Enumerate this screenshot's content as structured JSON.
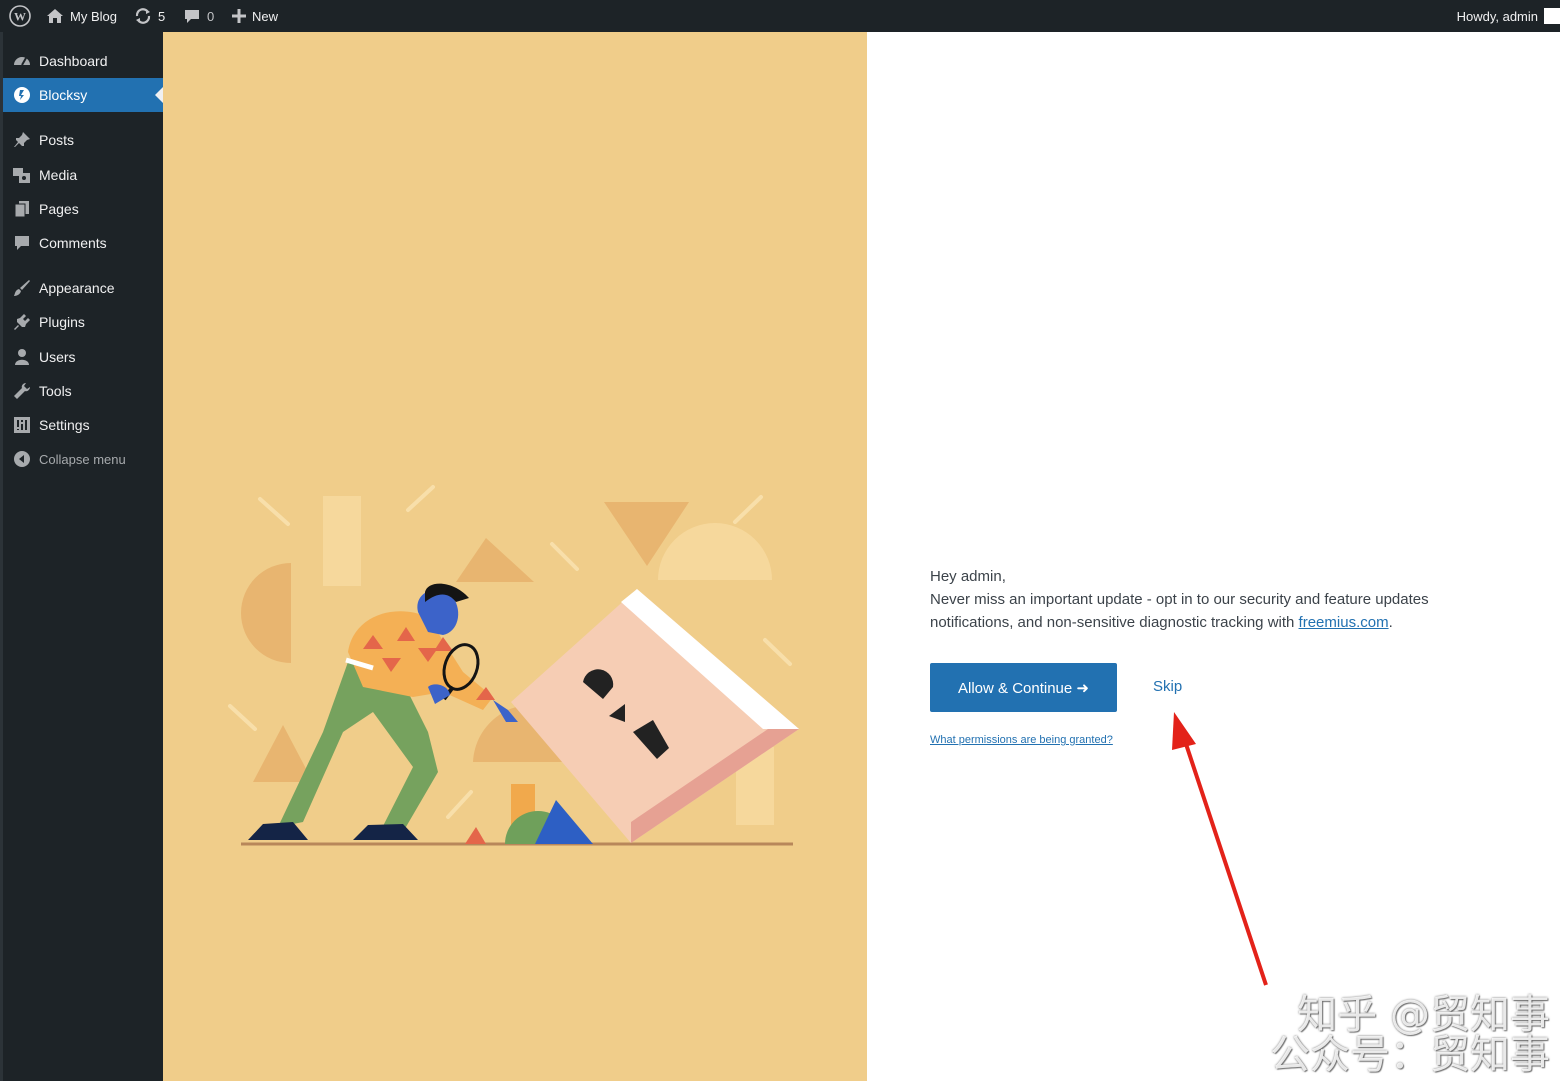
{
  "admin_bar": {
    "site_name": "My Blog",
    "updates_count": "5",
    "comments_count": "0",
    "new_label": "New",
    "howdy": "Howdy, admin"
  },
  "sidebar": {
    "items": [
      {
        "label": "Dashboard",
        "icon": "dashboard-icon"
      },
      {
        "label": "Blocksy",
        "icon": "blocksy-icon",
        "active": true
      },
      {
        "label": "Posts",
        "icon": "pin-icon"
      },
      {
        "label": "Media",
        "icon": "media-icon"
      },
      {
        "label": "Pages",
        "icon": "pages-icon"
      },
      {
        "label": "Comments",
        "icon": "comment-icon"
      },
      {
        "label": "Appearance",
        "icon": "brush-icon"
      },
      {
        "label": "Plugins",
        "icon": "plugin-icon"
      },
      {
        "label": "Users",
        "icon": "user-icon"
      },
      {
        "label": "Tools",
        "icon": "wrench-icon"
      },
      {
        "label": "Settings",
        "icon": "settings-icon"
      },
      {
        "label": "Collapse menu",
        "icon": "collapse-icon"
      }
    ]
  },
  "optin": {
    "greeting": "Hey admin,",
    "message": "Never miss an important update - opt in to our security and feature updates notifications, and non-sensitive diagnostic tracking with ",
    "link_text": "freemius.com",
    "period": ".",
    "allow_label": "Allow & Continue ➜",
    "skip_label": "Skip",
    "permissions_label": "What permissions are being granted?"
  },
  "watermark": {
    "line1": "知乎 @贸知事",
    "line2": "公众号：贸知事"
  },
  "colors": {
    "admin_bg": "#1d2327",
    "accent": "#2271b1",
    "illustration_bg": "#f0cd8a",
    "annotation_arrow": "#e32219"
  }
}
